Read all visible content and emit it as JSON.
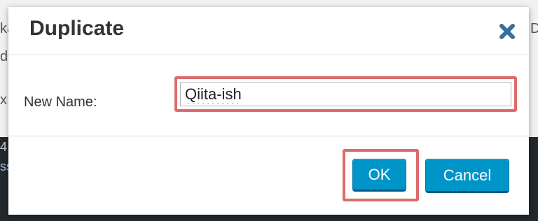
{
  "background": {
    "fragments": [
      "ka",
      "di",
      "x",
      "4",
      "ss",
      "D"
    ]
  },
  "dialog": {
    "title": "Duplicate",
    "close_icon": "close-x-icon",
    "field_label": "New Name:",
    "name_value": "Qiita-ish",
    "ok_label": "OK",
    "cancel_label": "Cancel"
  },
  "colors": {
    "primary_button": "#0095c8",
    "highlight_border": "#dc6b6e",
    "close_icon": "#3a6f9a"
  }
}
